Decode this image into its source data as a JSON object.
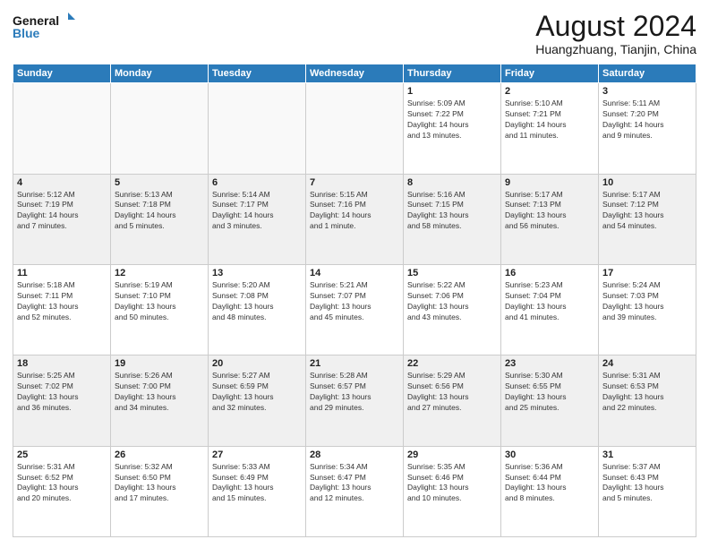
{
  "header": {
    "logo_line1": "General",
    "logo_line2": "Blue",
    "title": "August 2024",
    "subtitle": "Huangzhuang, Tianjin, China"
  },
  "weekdays": [
    "Sunday",
    "Monday",
    "Tuesday",
    "Wednesday",
    "Thursday",
    "Friday",
    "Saturday"
  ],
  "rows": [
    {
      "shade": false,
      "cells": [
        {
          "day": "",
          "info": ""
        },
        {
          "day": "",
          "info": ""
        },
        {
          "day": "",
          "info": ""
        },
        {
          "day": "",
          "info": ""
        },
        {
          "day": "1",
          "info": "Sunrise: 5:09 AM\nSunset: 7:22 PM\nDaylight: 14 hours\nand 13 minutes."
        },
        {
          "day": "2",
          "info": "Sunrise: 5:10 AM\nSunset: 7:21 PM\nDaylight: 14 hours\nand 11 minutes."
        },
        {
          "day": "3",
          "info": "Sunrise: 5:11 AM\nSunset: 7:20 PM\nDaylight: 14 hours\nand 9 minutes."
        }
      ]
    },
    {
      "shade": true,
      "cells": [
        {
          "day": "4",
          "info": "Sunrise: 5:12 AM\nSunset: 7:19 PM\nDaylight: 14 hours\nand 7 minutes."
        },
        {
          "day": "5",
          "info": "Sunrise: 5:13 AM\nSunset: 7:18 PM\nDaylight: 14 hours\nand 5 minutes."
        },
        {
          "day": "6",
          "info": "Sunrise: 5:14 AM\nSunset: 7:17 PM\nDaylight: 14 hours\nand 3 minutes."
        },
        {
          "day": "7",
          "info": "Sunrise: 5:15 AM\nSunset: 7:16 PM\nDaylight: 14 hours\nand 1 minute."
        },
        {
          "day": "8",
          "info": "Sunrise: 5:16 AM\nSunset: 7:15 PM\nDaylight: 13 hours\nand 58 minutes."
        },
        {
          "day": "9",
          "info": "Sunrise: 5:17 AM\nSunset: 7:13 PM\nDaylight: 13 hours\nand 56 minutes."
        },
        {
          "day": "10",
          "info": "Sunrise: 5:17 AM\nSunset: 7:12 PM\nDaylight: 13 hours\nand 54 minutes."
        }
      ]
    },
    {
      "shade": false,
      "cells": [
        {
          "day": "11",
          "info": "Sunrise: 5:18 AM\nSunset: 7:11 PM\nDaylight: 13 hours\nand 52 minutes."
        },
        {
          "day": "12",
          "info": "Sunrise: 5:19 AM\nSunset: 7:10 PM\nDaylight: 13 hours\nand 50 minutes."
        },
        {
          "day": "13",
          "info": "Sunrise: 5:20 AM\nSunset: 7:08 PM\nDaylight: 13 hours\nand 48 minutes."
        },
        {
          "day": "14",
          "info": "Sunrise: 5:21 AM\nSunset: 7:07 PM\nDaylight: 13 hours\nand 45 minutes."
        },
        {
          "day": "15",
          "info": "Sunrise: 5:22 AM\nSunset: 7:06 PM\nDaylight: 13 hours\nand 43 minutes."
        },
        {
          "day": "16",
          "info": "Sunrise: 5:23 AM\nSunset: 7:04 PM\nDaylight: 13 hours\nand 41 minutes."
        },
        {
          "day": "17",
          "info": "Sunrise: 5:24 AM\nSunset: 7:03 PM\nDaylight: 13 hours\nand 39 minutes."
        }
      ]
    },
    {
      "shade": true,
      "cells": [
        {
          "day": "18",
          "info": "Sunrise: 5:25 AM\nSunset: 7:02 PM\nDaylight: 13 hours\nand 36 minutes."
        },
        {
          "day": "19",
          "info": "Sunrise: 5:26 AM\nSunset: 7:00 PM\nDaylight: 13 hours\nand 34 minutes."
        },
        {
          "day": "20",
          "info": "Sunrise: 5:27 AM\nSunset: 6:59 PM\nDaylight: 13 hours\nand 32 minutes."
        },
        {
          "day": "21",
          "info": "Sunrise: 5:28 AM\nSunset: 6:57 PM\nDaylight: 13 hours\nand 29 minutes."
        },
        {
          "day": "22",
          "info": "Sunrise: 5:29 AM\nSunset: 6:56 PM\nDaylight: 13 hours\nand 27 minutes."
        },
        {
          "day": "23",
          "info": "Sunrise: 5:30 AM\nSunset: 6:55 PM\nDaylight: 13 hours\nand 25 minutes."
        },
        {
          "day": "24",
          "info": "Sunrise: 5:31 AM\nSunset: 6:53 PM\nDaylight: 13 hours\nand 22 minutes."
        }
      ]
    },
    {
      "shade": false,
      "cells": [
        {
          "day": "25",
          "info": "Sunrise: 5:31 AM\nSunset: 6:52 PM\nDaylight: 13 hours\nand 20 minutes."
        },
        {
          "day": "26",
          "info": "Sunrise: 5:32 AM\nSunset: 6:50 PM\nDaylight: 13 hours\nand 17 minutes."
        },
        {
          "day": "27",
          "info": "Sunrise: 5:33 AM\nSunset: 6:49 PM\nDaylight: 13 hours\nand 15 minutes."
        },
        {
          "day": "28",
          "info": "Sunrise: 5:34 AM\nSunset: 6:47 PM\nDaylight: 13 hours\nand 12 minutes."
        },
        {
          "day": "29",
          "info": "Sunrise: 5:35 AM\nSunset: 6:46 PM\nDaylight: 13 hours\nand 10 minutes."
        },
        {
          "day": "30",
          "info": "Sunrise: 5:36 AM\nSunset: 6:44 PM\nDaylight: 13 hours\nand 8 minutes."
        },
        {
          "day": "31",
          "info": "Sunrise: 5:37 AM\nSunset: 6:43 PM\nDaylight: 13 hours\nand 5 minutes."
        }
      ]
    }
  ]
}
